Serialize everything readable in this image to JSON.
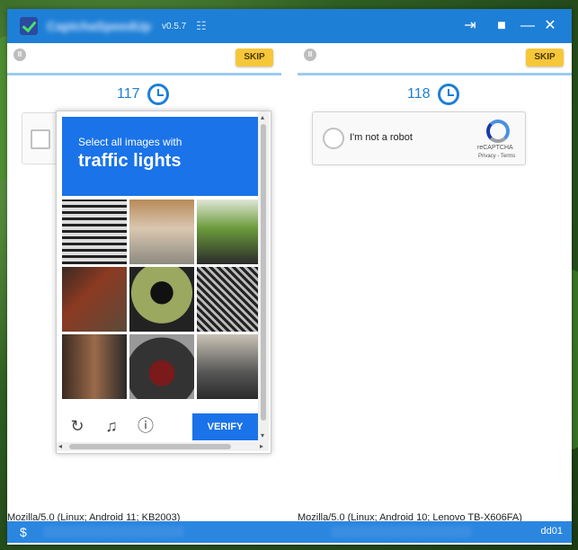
{
  "app": {
    "title": "CaptchaSpeedUp",
    "version": "v0.5.7"
  },
  "panes": [
    {
      "skip_label": "SKIP",
      "timer": "117",
      "user_agent": "Mozilla/5.0 (Linux; Android 11; KB2003)"
    },
    {
      "skip_label": "SKIP",
      "timer": "118",
      "user_agent": "Mozilla/5.0 (Linux; Android 10; Lenovo TB-X606FA)",
      "checkbox_label": "I'm not a robot",
      "brand": "reCAPTCHA",
      "links": "Privacy - Terms"
    }
  ],
  "challenge": {
    "instruction": "Select all images with",
    "target": "traffic lights",
    "verify_label": "VERIFY"
  },
  "status": {
    "left_symbol": "$",
    "right": "dd01"
  },
  "colors": {
    "primary": "#1e7fd6",
    "skip": "#f7c73a",
    "recaptcha_blue": "#1a73e8"
  }
}
